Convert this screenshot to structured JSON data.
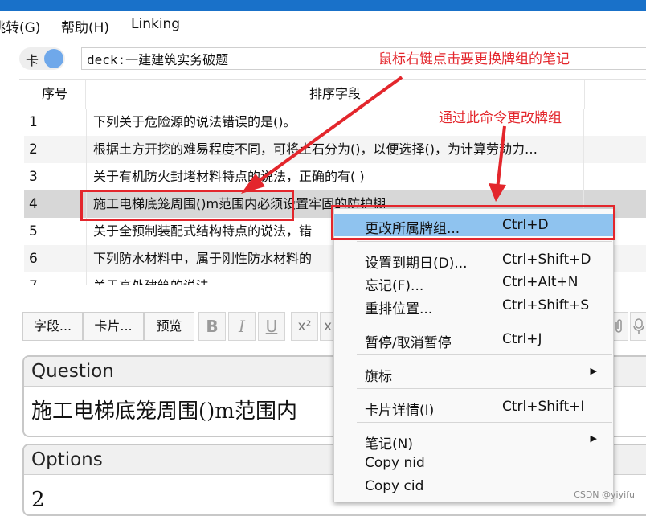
{
  "menubar": {
    "goto": "跳转(G)",
    "help": "帮助(H)",
    "linking": "Linking"
  },
  "search": {
    "toggle_label": "卡",
    "value": "deck:一建建筑实务破题"
  },
  "table": {
    "headers": {
      "number": "序号",
      "sort_field": "排序字段"
    },
    "rows": [
      {
        "n": "1",
        "text": "下列关于危险源的说法错误的是()。"
      },
      {
        "n": "2",
        "text": "根据土方开挖的难易程度不同，可将土石分为()，以便选择()，为计算劳动力…"
      },
      {
        "n": "3",
        "text": "关于有机防火封堵材料特点的说法，正确的有( )"
      },
      {
        "n": "4",
        "text": "施工电梯底笼周围()m范围内必须设置牢固的防护棚"
      },
      {
        "n": "5",
        "text": "关于全预制装配式结构特点的说法，错"
      },
      {
        "n": "6",
        "text": "下列防水材料中，属于刚性防水材料的"
      },
      {
        "n": "7",
        "text": "关于高处建筑的说法"
      }
    ]
  },
  "toolbar": {
    "fields": "字段...",
    "cards": "卡片...",
    "preview": "预览",
    "bold": "B",
    "italic": "I",
    "underline": "U",
    "superscript": "x²",
    "sub_partial": "x"
  },
  "fields": {
    "question": {
      "name": "Question",
      "content": "施工电梯底笼周围()m范围内"
    },
    "options": {
      "name": "Options",
      "content": "2"
    }
  },
  "context_menu": {
    "items": [
      {
        "label": "更改所属牌组...",
        "shortcut": "Ctrl+D"
      },
      {
        "label": "设置到期日(D)...",
        "shortcut": "Ctrl+Shift+D"
      },
      {
        "label": "忘记(F)...",
        "shortcut": "Ctrl+Alt+N"
      },
      {
        "label": "重排位置...",
        "shortcut": "Ctrl+Shift+S"
      },
      {
        "label": "暂停/取消暂停",
        "shortcut": "Ctrl+J"
      },
      {
        "label": "旗标",
        "shortcut": ""
      },
      {
        "label": "卡片详情(I)",
        "shortcut": "Ctrl+Shift+I"
      },
      {
        "label": "笔记(N)",
        "shortcut": ""
      },
      {
        "label": "Copy nid",
        "shortcut": ""
      },
      {
        "label": "Copy cid",
        "shortcut": ""
      }
    ]
  },
  "annotations": {
    "right_click_note": "鼠标右键点击要更换牌组的笔记",
    "change_deck_note": "通过此命令更改牌组",
    "watermark": "CSDN @yiyifu"
  },
  "colors": {
    "accent_red": "#e3262c",
    "highlight_blue": "#8fc3ef",
    "titlebar": "#1971c9"
  }
}
